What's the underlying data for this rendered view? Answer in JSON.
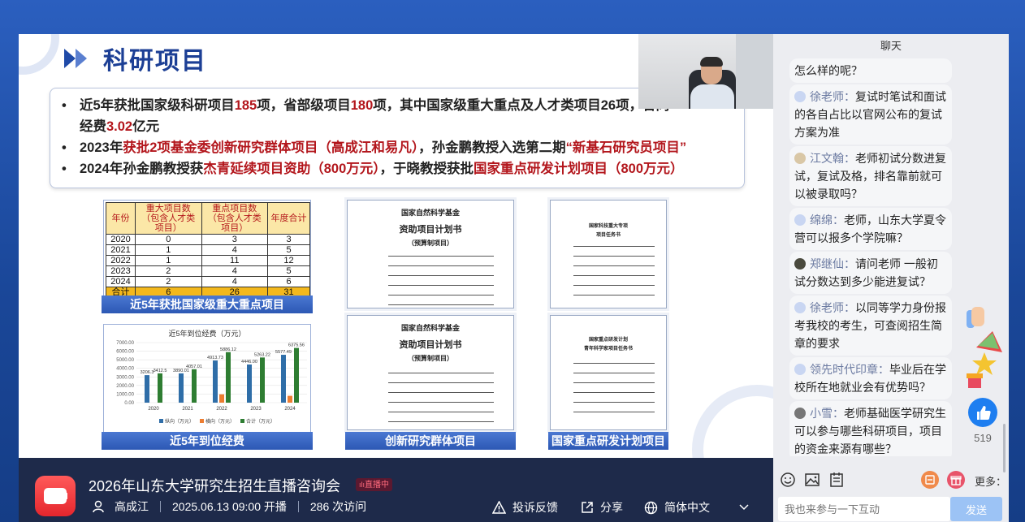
{
  "slide": {
    "title": "科研项目",
    "bullets": [
      {
        "parts": [
          "近5年获批国家级科研项目",
          "185",
          "项，省部级项目",
          "180",
          "项，其中国家级重大重点及人才类项目26项，合同"
        ]
      },
      {
        "parts": [
          "经费",
          "3.02",
          "亿元"
        ]
      },
      {
        "parts": [
          "2023年",
          "获批2项基金委创新研究群体项目（高成江和易凡）",
          "，孙金鹏教授入选第二期",
          "“新基石研究员项目”",
          ""
        ]
      },
      {
        "parts": [
          "2024年孙金鹏教授获",
          "杰青延续项目资助（800万元）",
          "，于晓教授获批",
          "国家重点研发计划项目（800万元）",
          ""
        ]
      }
    ],
    "table": {
      "headers": [
        "年份",
        "重大项目数（包含人才类项目）",
        "重点项目数（包含人才类项目）",
        "年度合计"
      ],
      "rows": [
        [
          "2020",
          "0",
          "3",
          "3"
        ],
        [
          "2021",
          "1",
          "4",
          "5"
        ],
        [
          "2022",
          "1",
          "11",
          "12"
        ],
        [
          "2023",
          "2",
          "4",
          "5"
        ],
        [
          "2024",
          "2",
          "4",
          "6"
        ]
      ],
      "total": [
        "合计",
        "6",
        "26",
        "31"
      ],
      "caption": "近5年获批国家级重大重点项目"
    },
    "chart_caption": "近5年到位经费",
    "doc1": {
      "org": "国家自然科学基金",
      "title": "资助项目计划书",
      "sub": "（预算制项目）"
    },
    "doc2": {
      "org": "国家自然科学基金",
      "title": "资助项目计划书",
      "sub": "（预算制项目）"
    },
    "doc3": {
      "org": "国家科技重大专项",
      "title": "项目任务书"
    },
    "doc4": {
      "org": "国家重点研发计划",
      "title": "青年科学家项目任务书"
    },
    "doc_caption_left": "创新研究群体项目",
    "doc_caption_right": "国家重点研发计划项目"
  },
  "chart_data": {
    "type": "bar",
    "title": "近5年到位经费（万元）",
    "categories": [
      "2020",
      "2021",
      "2022",
      "2023",
      "2024"
    ],
    "series": [
      {
        "name": "纵向（万元）",
        "color": "#2f6ea8",
        "values": [
          3206.3,
          3412.5,
          4913.73,
          4446,
          5577.49
        ]
      },
      {
        "name": "横向（万元）",
        "color": "#ed7d31",
        "values": [
          0,
          0,
          972.39,
          0,
          800.07
        ]
      },
      {
        "name": "合计（万元）",
        "color": "#2e7d32",
        "values": [
          3412.5,
          3890.01,
          5886.12,
          5263.22,
          6375.56
        ]
      }
    ],
    "data_labels": [
      "3206.3",
      "3412.5",
      "3890.01",
      "4057.01",
      "4913.73",
      "5886.12",
      "4446.00",
      "5263.22",
      "5577.49",
      "6375.56"
    ],
    "yticks": [
      "0.00",
      "1000.00",
      "2000.00",
      "3000.00",
      "4000.00",
      "5000.00",
      "6000.00",
      "7000.00"
    ],
    "ylim": [
      0,
      7000
    ],
    "legend_position": "bottom"
  },
  "stream": {
    "title": "2026年山东大学研究生招生直播咨询会",
    "live_badge": "直播中",
    "host": "高成江",
    "time": "2025.06.13 09:00 开播",
    "visits": "286 次访问",
    "report": "投诉反馈",
    "share": "分享",
    "language": "简体中文"
  },
  "chat": {
    "header": "聊天",
    "messages": [
      {
        "name": "",
        "text": "怎么样的呢？"
      },
      {
        "name": "徐老师：",
        "text": "复试时笔试和面试的各自占比以官网公布的复试方案为准"
      },
      {
        "name": "江文翰：",
        "text": "老师初试分数进复试，复试及格，排名靠前就可以被录取吗？"
      },
      {
        "name": "绵绵：",
        "text": "老师，山东大学夏令营可以报多个学院嘛？"
      },
      {
        "name": "郑继仙：",
        "text": "请问老师 一般初试分数达到多少能进复试？"
      },
      {
        "name": "徐老师：",
        "text": "以同等学力身份报考我校的考生，可查阅招生简章的要求"
      },
      {
        "name": "领先时代印章：",
        "text": "毕业后在学校所在地就业会有优势吗？"
      },
      {
        "name": "小雪：",
        "text": "老师基础医学研究生可以参与哪些科研项目，项目的资金来源有哪些？"
      }
    ],
    "like_count": "519",
    "more": "更多：",
    "placeholder": "我也来参与一下互动",
    "send": "发送"
  }
}
